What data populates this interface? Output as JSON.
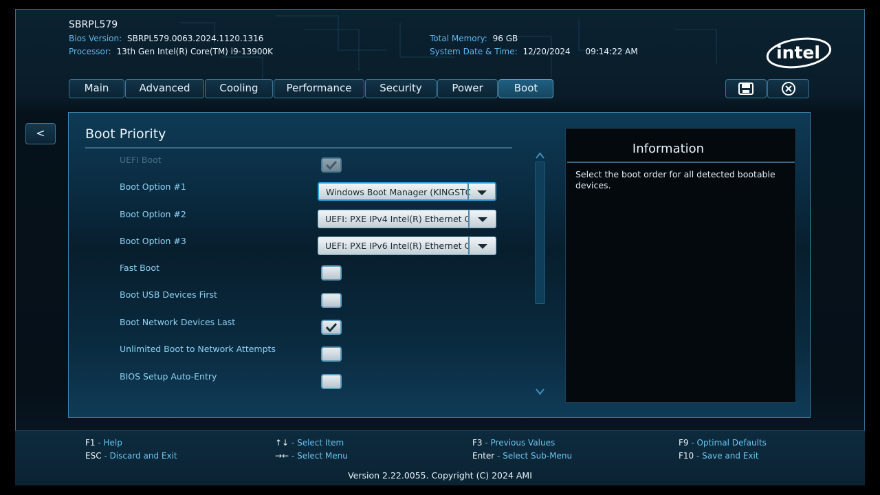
{
  "header": {
    "system_name": "SBRPL579",
    "bios_version_label": "Bios Version:",
    "bios_version": "SBRPL579.0063.2024.1120.1316",
    "processor_label": "Processor:",
    "processor": "13th Gen Intel(R) Core(TM) i9-13900K",
    "memory_label": "Total Memory:",
    "memory": "96 GB",
    "datetime_label": "System Date & Time:",
    "date": "12/20/2024",
    "time": "09:14:22 AM",
    "logo_text": "intel"
  },
  "tabs": [
    {
      "label": "Main"
    },
    {
      "label": "Advanced"
    },
    {
      "label": "Cooling"
    },
    {
      "label": "Performance"
    },
    {
      "label": "Security"
    },
    {
      "label": "Power"
    },
    {
      "label": "Boot",
      "active": true
    }
  ],
  "toolbar_icons": [
    "save-icon",
    "close-icon"
  ],
  "back_button": "<",
  "section": {
    "title": "Boot Priority",
    "options": [
      {
        "label": "UEFI Boot",
        "type": "checkbox",
        "checked": true,
        "disabled": true
      },
      {
        "label": "Boot Option #1",
        "type": "dropdown",
        "value": "Windows Boot Manager (KINGSTO",
        "focused": true
      },
      {
        "label": "Boot Option #2",
        "type": "dropdown",
        "value": "UEFI: PXE IPv4 Intel(R) Ethernet C"
      },
      {
        "label": "Boot Option #3",
        "type": "dropdown",
        "value": "UEFI: PXE IPv6 Intel(R) Ethernet C"
      },
      {
        "label": "Fast Boot",
        "type": "checkbox",
        "checked": false
      },
      {
        "label": "Boot USB Devices First",
        "type": "checkbox",
        "checked": false
      },
      {
        "label": "Boot Network Devices Last",
        "type": "checkbox",
        "checked": true
      },
      {
        "label": "Unlimited Boot to Network Attempts",
        "type": "checkbox",
        "checked": false
      },
      {
        "label": "BIOS Setup Auto-Entry",
        "type": "checkbox",
        "checked": false
      }
    ]
  },
  "info": {
    "title": "Information",
    "text": "Select the boot order for all detected bootable devices."
  },
  "footer": {
    "keys": [
      {
        "key": "F1",
        "desc": "Help"
      },
      {
        "key": "ESC",
        "desc": "Discard and Exit"
      },
      {
        "key": "↑↓",
        "desc": "Select Item"
      },
      {
        "key": "→←",
        "desc": "Select Menu"
      },
      {
        "key": "F3",
        "desc": "Previous Values"
      },
      {
        "key": "Enter",
        "desc": "Select Sub-Menu"
      },
      {
        "key": "F9",
        "desc": "Optimal Defaults"
      },
      {
        "key": "F10",
        "desc": "Save and Exit"
      }
    ],
    "separator": " - ",
    "version": "Version 2.22.0055. Copyright (C) 2024 AMI"
  },
  "colors": {
    "accent": "#5fb4ea",
    "active_tab": "#1f5f82",
    "panel_border": "#3c84ab"
  }
}
